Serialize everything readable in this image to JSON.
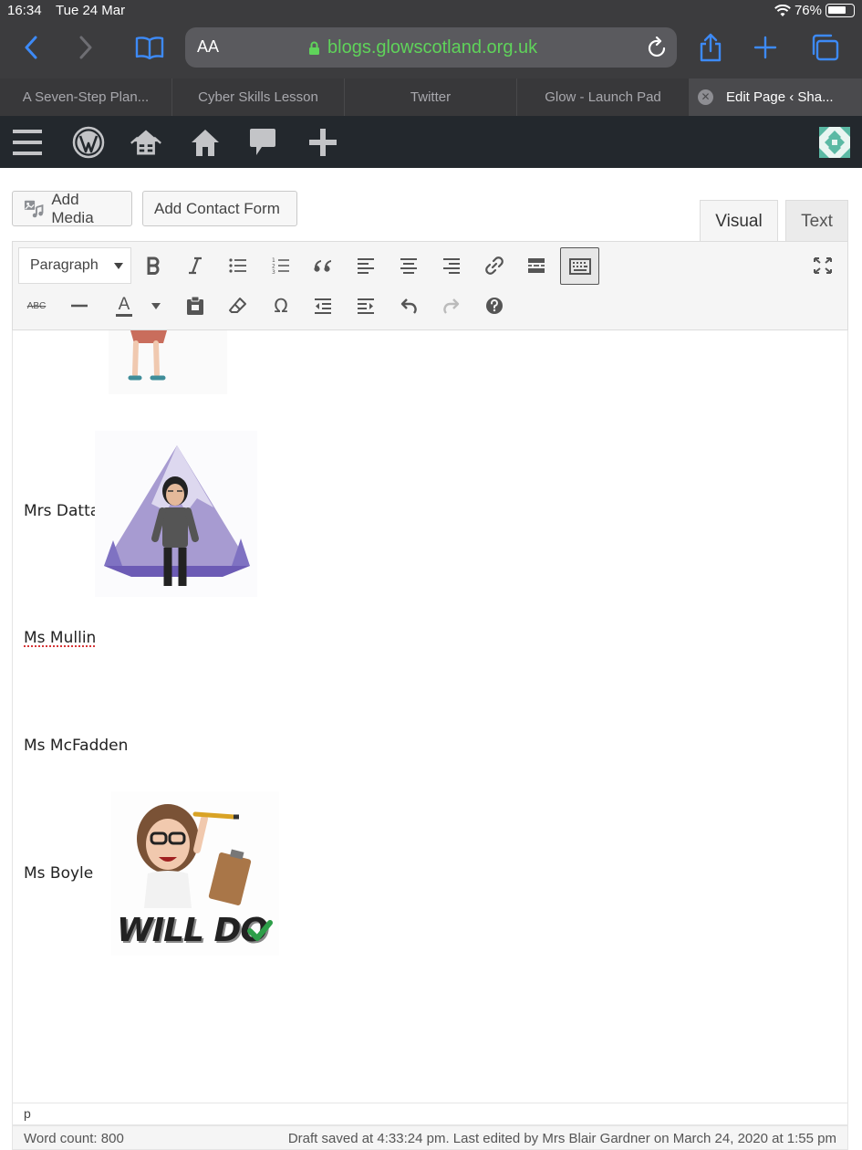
{
  "status_bar": {
    "time": "16:34",
    "date": "Tue 24 Mar",
    "battery": "76%",
    "battery_level": 0.76
  },
  "browser": {
    "text_size_label": "AA",
    "url": "blogs.glowscotland.org.uk",
    "tabs": [
      {
        "label": "A Seven-Step Plan..."
      },
      {
        "label": "Cyber Skills Lesson"
      },
      {
        "label": "Twitter"
      },
      {
        "label": "Glow - Launch Pad"
      },
      {
        "label": "Edit Page ‹ Sha..."
      }
    ]
  },
  "editor": {
    "add_media_label": "Add Media",
    "add_contact_form_label": "Add Contact Form",
    "visual_tab_label": "Visual",
    "text_tab_label": "Text",
    "format_select_value": "Paragraph",
    "text_color_label": "A",
    "strike_label": "ABC"
  },
  "content": {
    "staff": [
      {
        "name": "Mrs Datta"
      },
      {
        "name": "Ms Mullin"
      },
      {
        "name": "Ms McFadden"
      },
      {
        "name": "Ms Boyle"
      }
    ],
    "will_do_text": "WILL DO"
  },
  "footer": {
    "path": "p",
    "word_count": "Word count: 800",
    "draft_status": "Draft saved at 4:33:24 pm. Last edited by Mrs Blair Gardner on March 24, 2020 at 1:55 pm"
  },
  "colors": {
    "wp_admin_bar": "#23282d",
    "url_green": "#5fd35a",
    "ios_blue": "#3d8af7"
  }
}
